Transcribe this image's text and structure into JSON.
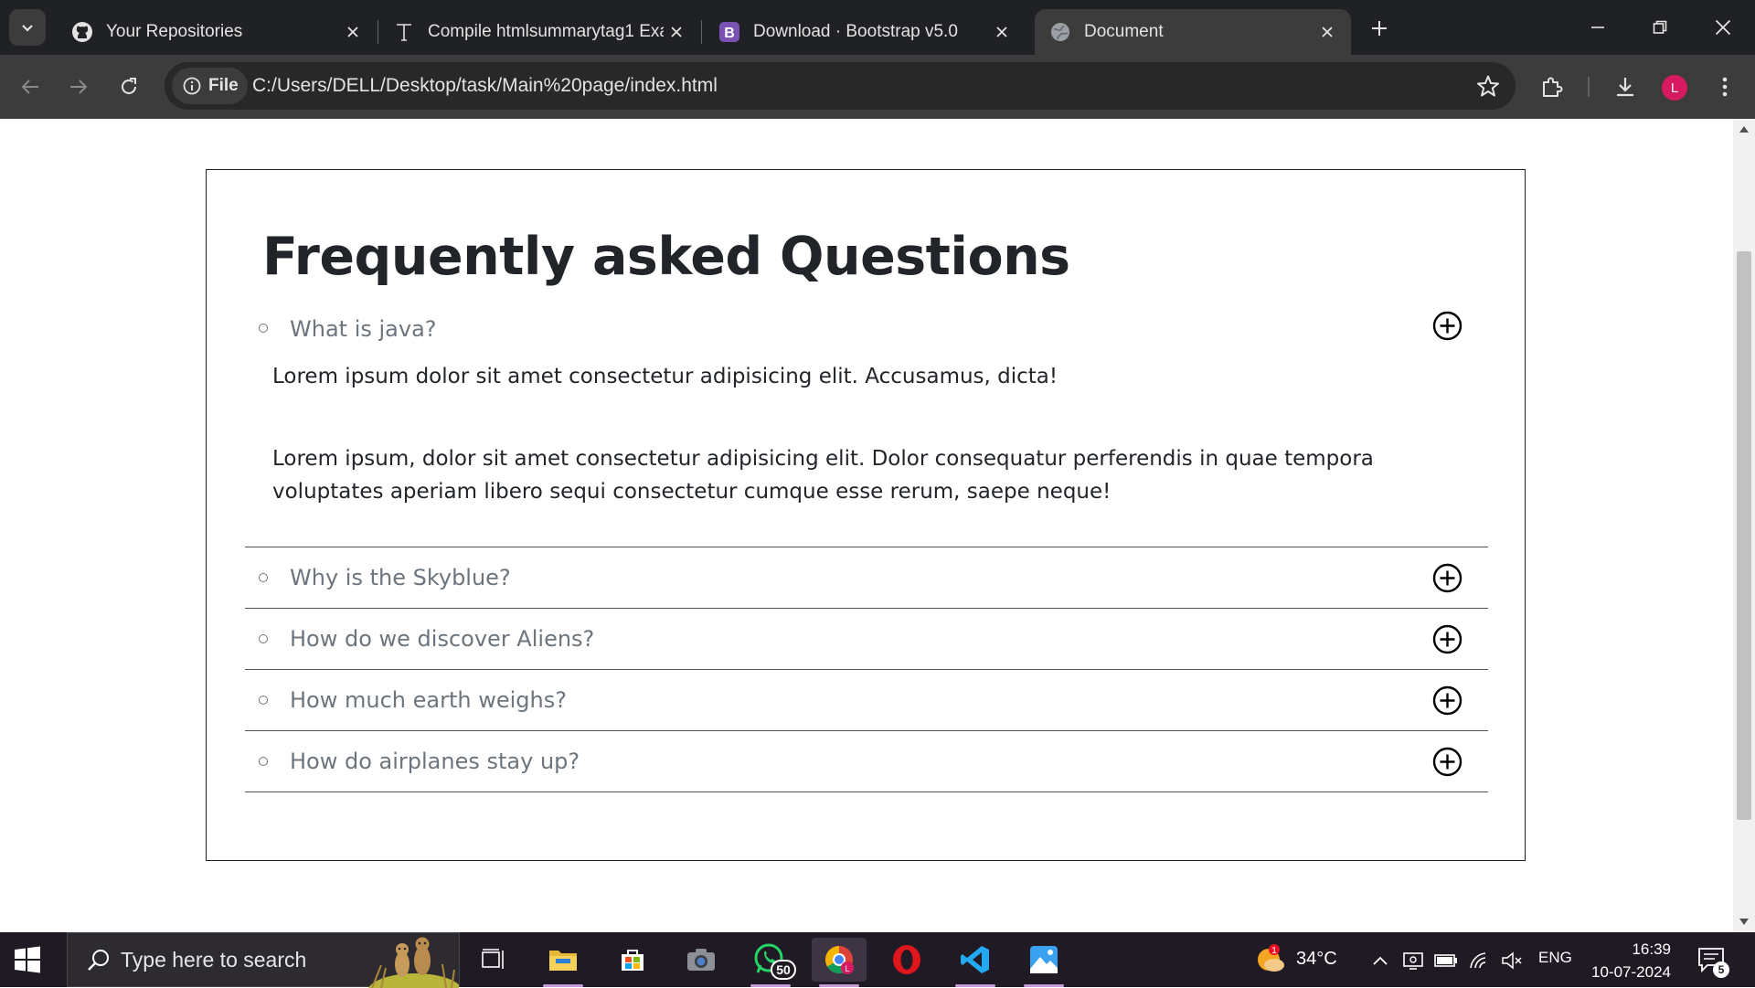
{
  "browser": {
    "tabs": [
      {
        "title": "Your Repositories",
        "icon": "github-icon",
        "active": false
      },
      {
        "title": "Compile htmlsummarytag1 Exa",
        "icon": "text-t-icon",
        "active": false
      },
      {
        "title": "Download · Bootstrap v5.0",
        "icon": "bootstrap-icon",
        "active": false
      },
      {
        "title": "Document",
        "icon": "globe-icon",
        "active": true
      }
    ],
    "address": {
      "chip_label": "File",
      "url": "C:/Users/DELL/Desktop/task/Main%20page/index.html"
    },
    "profile_initial": "L",
    "colors": {
      "tab_bar": "#202124",
      "toolbar": "#3c3c3c",
      "omnibox": "#282828",
      "avatar": "#d81b60"
    }
  },
  "page": {
    "title": "Frequently asked Questions",
    "faq": [
      {
        "question": "What is java?",
        "expanded": true,
        "answer": [
          "Lorem ipsum dolor sit amet consectetur adipisicing elit. Accusamus, dicta!",
          "Lorem ipsum, dolor sit amet consectetur adipisicing elit. Dolor consequatur perferendis in quae tempora voluptates aperiam libero sequi consectetur cumque esse rerum, saepe neque!"
        ]
      },
      {
        "question": "Why is the Skyblue?",
        "expanded": false
      },
      {
        "question": "How do we discover Aliens?",
        "expanded": false
      },
      {
        "question": "How much earth weighs?",
        "expanded": false
      },
      {
        "question": "How do airplanes stay up?",
        "expanded": false
      }
    ],
    "colors": {
      "question_text": "#6c757d",
      "answer_text": "#212529",
      "border": "#222222"
    }
  },
  "taskbar": {
    "search_placeholder": "Type here to search",
    "whatsapp_badge": "50",
    "weather": {
      "temperature": "34°C",
      "alert_count": "1"
    },
    "language": "ENG",
    "time": "16:39",
    "date": "10-07-2024",
    "notification_count": "5",
    "colors": {
      "background": "#1f1a24"
    }
  }
}
